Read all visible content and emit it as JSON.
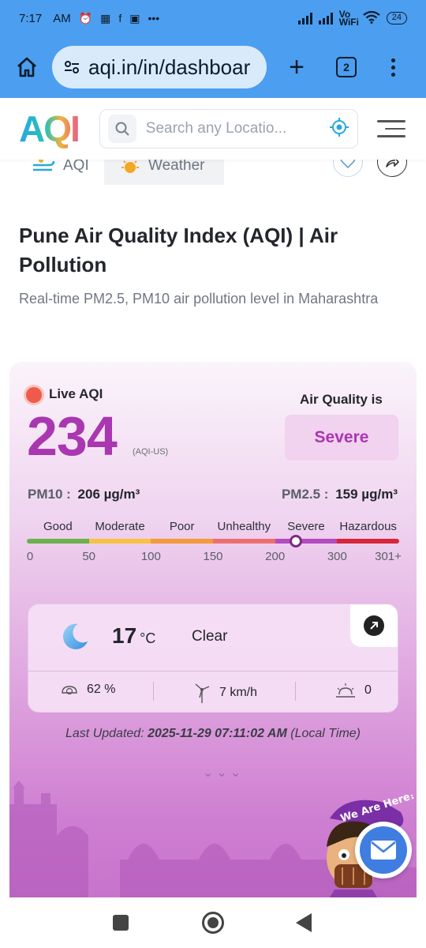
{
  "status_bar": {
    "time": "7:17",
    "ampm": "AM",
    "wifi_label": "Vo WiFi",
    "battery": "24"
  },
  "browser": {
    "url": "aqi.in/in/dashboar",
    "tab_count": "2"
  },
  "site_header": {
    "logo_text": "AQI",
    "search_placeholder": "Search any Locatio..."
  },
  "tabs": {
    "aqi_label": "AQI",
    "weather_label": "Weather"
  },
  "page": {
    "title": "Pune Air Quality Index (AQI) | Air Pollution",
    "subtitle": "Real-time PM2.5, PM10 air pollution level in Maharashtra"
  },
  "aqi_card": {
    "live_label": "Live AQI",
    "aqi_value": "234",
    "aqi_unit": "(AQI-US)",
    "air_quality_label": "Air Quality is",
    "status": "Severe",
    "status_color": "#a937b0",
    "pm10_key": "PM10 :",
    "pm10_value": "206 µg/m³",
    "pm25_key": "PM2.5 :",
    "pm25_value": "159 µg/m³",
    "scale_categories": [
      "Good",
      "Moderate",
      "Poor",
      "Unhealthy",
      "Severe",
      "Hazardous"
    ],
    "scale_colors": [
      "#6ab04c",
      "#f6c343",
      "#f39a3b",
      "#ec6f6f",
      "#b24cc0",
      "#d6263b"
    ],
    "scale_ticks": [
      "0",
      "50",
      "100",
      "150",
      "200",
      "300",
      "301+"
    ],
    "marker_value": 234
  },
  "weather": {
    "temperature": "17",
    "temperature_unit": "°C",
    "condition": "Clear",
    "humidity": "62 %",
    "wind": "7 km/h",
    "uv": "0"
  },
  "updated": {
    "prefix": "Last Updated:",
    "timestamp": "2025-11-29 07:11:02 AM",
    "suffix": "(Local Time)"
  },
  "chat": {
    "banner_text": "We Are Here!"
  }
}
